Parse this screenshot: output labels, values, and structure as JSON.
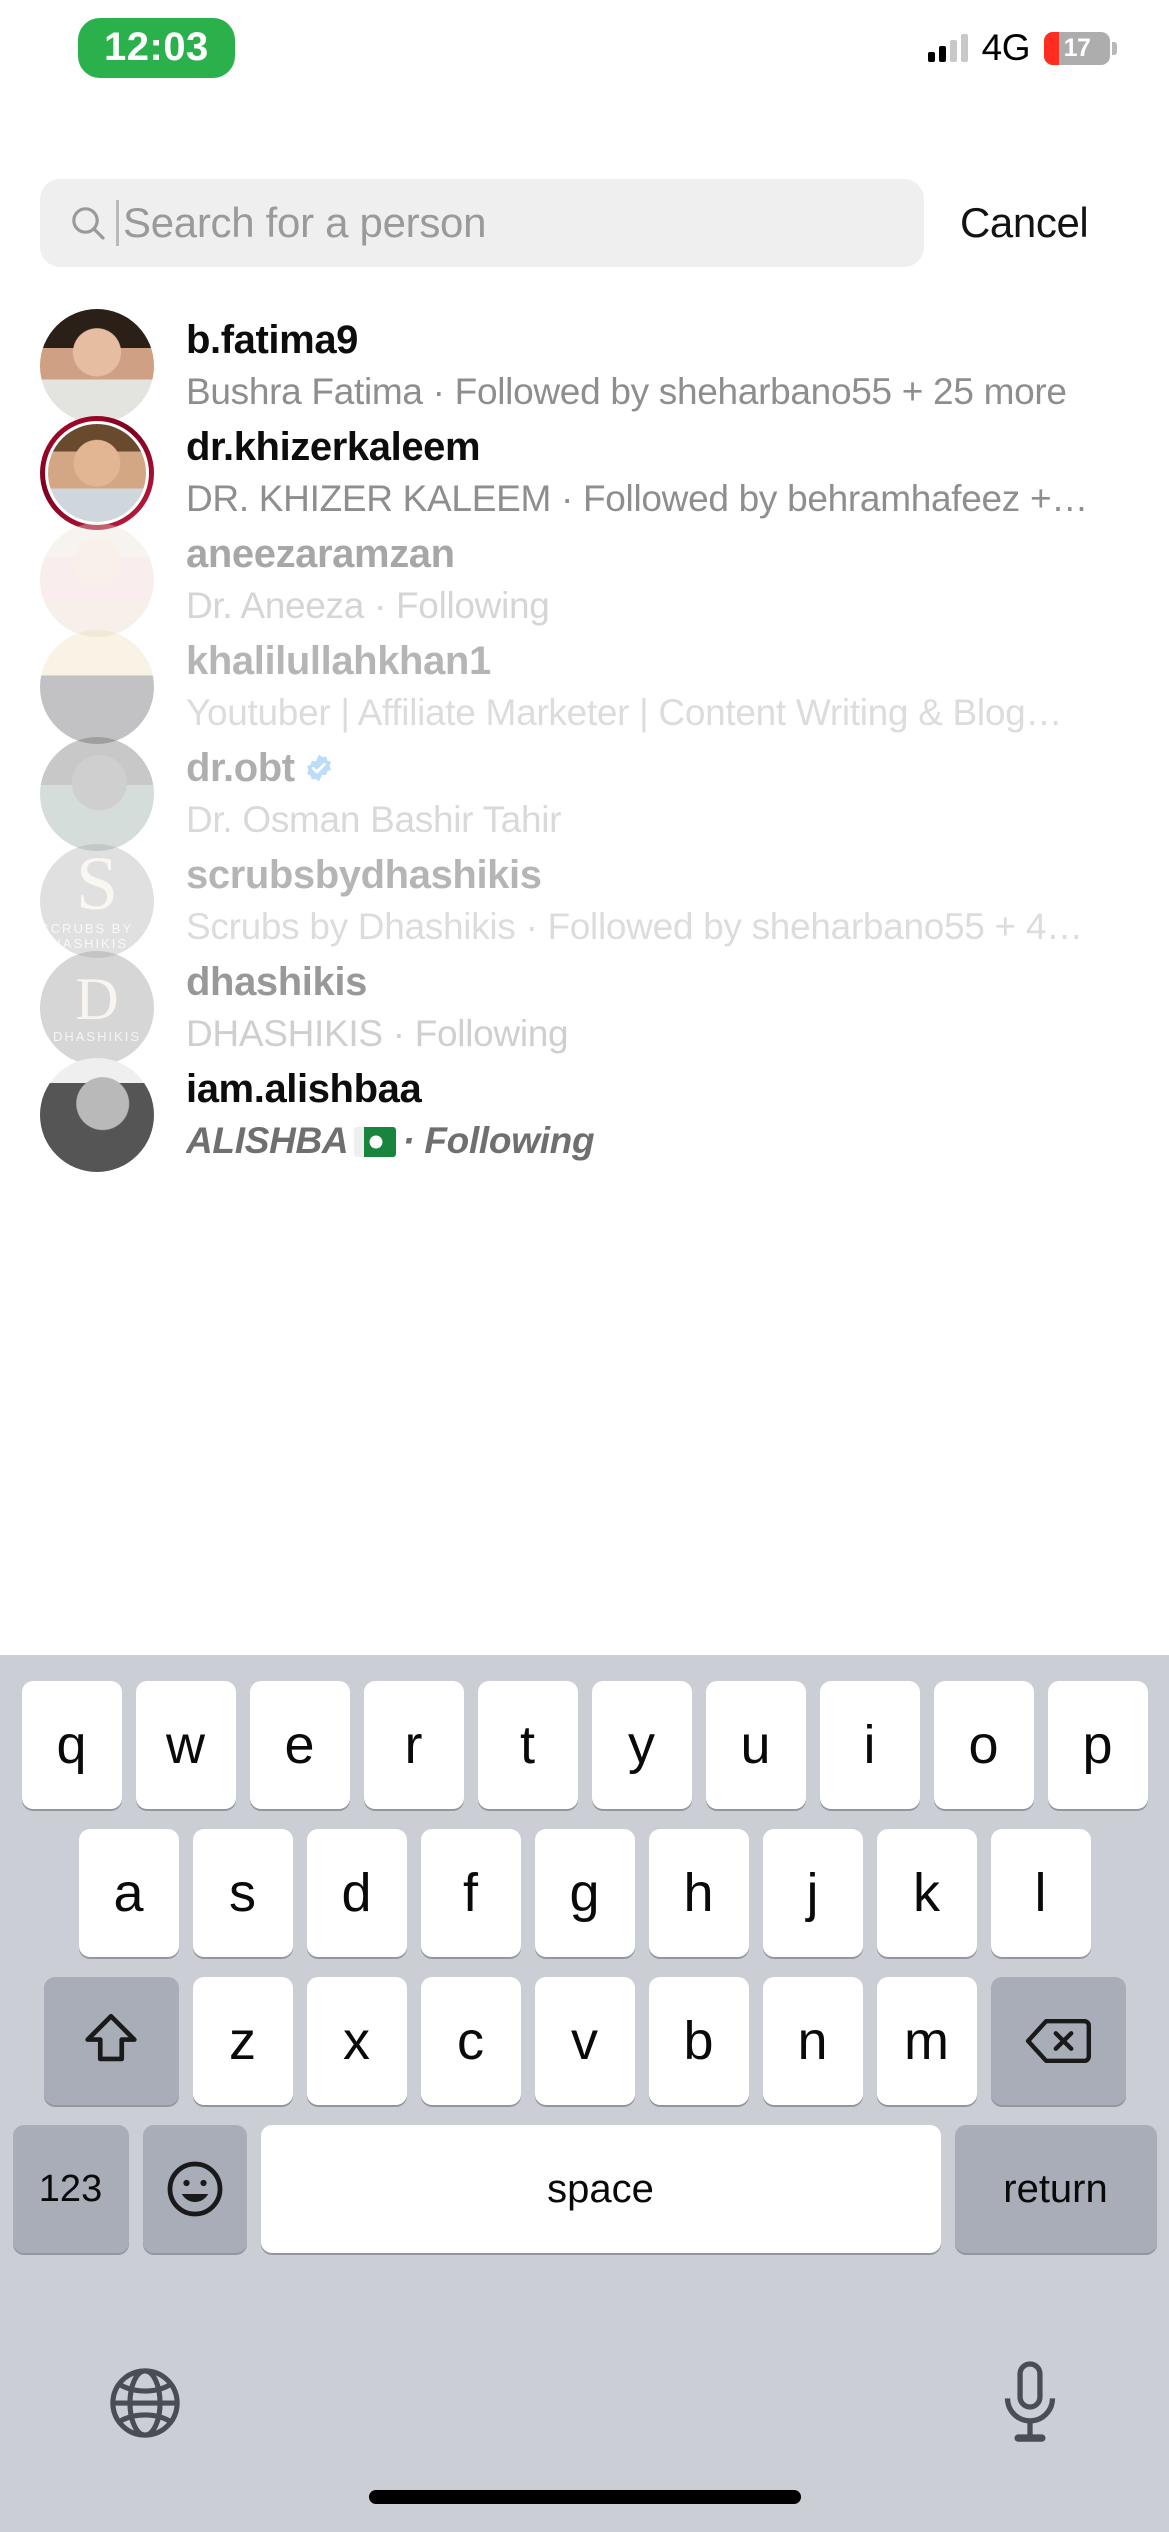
{
  "status_bar": {
    "time": "12:03",
    "time_pill_color": "#2bb14b",
    "network": "4G",
    "battery_percent": "17",
    "battery_low_color": "#ff2d20",
    "signal_icon": "cellular-signal-icon"
  },
  "search": {
    "placeholder": "Search for a person",
    "value": "",
    "icon": "search-icon",
    "cancel_label": "Cancel"
  },
  "results": [
    {
      "username": "b.fatima9",
      "subtitle": "Bushra Fatima · Followed by sheharbano55 + 25 more",
      "verified": false,
      "story_ring": false,
      "avatar": "profile-photo-b-fatima9"
    },
    {
      "username": "dr.khizerkaleem",
      "subtitle": "DR. KHIZER KALEEM · Followed by behramhafeez +…",
      "verified": false,
      "story_ring": true,
      "ring_color": "#a4082a",
      "avatar": "profile-photo-dr-khizerkaleem"
    },
    {
      "username": "aneezaramzan",
      "subtitle": "Dr. Aneeza · Following",
      "verified": false,
      "story_ring": false,
      "avatar": "profile-photo-aneezaramzan"
    },
    {
      "username": "khalilullahkhan1",
      "subtitle": "Youtuber | Affiliate Marketer | Content Writing & Blog…",
      "verified": false,
      "story_ring": false,
      "avatar": "profile-photo-khalilullahkhan1"
    },
    {
      "username": "dr.obt",
      "subtitle": "Dr. Osman Bashir Tahir",
      "verified": true,
      "verified_color": "#3897f0",
      "story_ring": false,
      "avatar": "profile-photo-dr-obt"
    },
    {
      "username": "scrubsbydhashikis",
      "subtitle": "Scrubs by Dhashikis · Followed by sheharbano55 + 4…",
      "verified": false,
      "story_ring": false,
      "avatar": "logo-scrubsbydhashikis",
      "logo_big": "S",
      "logo_small": "SCRUBS BY DHASHIKIS"
    },
    {
      "username": "dhashikis",
      "subtitle": "DHASHIKIS · Following",
      "verified": false,
      "story_ring": false,
      "avatar": "logo-dhashikis",
      "logo_big": "D",
      "logo_small": "DHASHIKIS"
    },
    {
      "username": "iam.alishbaa",
      "subtitle_prefix": "ALISHBA",
      "subtitle_suffix": "· Following",
      "flag": "pakistan-flag-emoji",
      "verified": false,
      "story_ring": false,
      "avatar": "profile-photo-iam-alishbaa"
    }
  ],
  "keyboard": {
    "row1": [
      "q",
      "w",
      "e",
      "r",
      "t",
      "y",
      "u",
      "i",
      "o",
      "p"
    ],
    "row2": [
      "a",
      "s",
      "d",
      "f",
      "g",
      "h",
      "j",
      "k",
      "l"
    ],
    "row3": [
      "z",
      "x",
      "c",
      "v",
      "b",
      "n",
      "m"
    ],
    "shift_icon": "shift-arrow-icon",
    "backspace_icon": "backspace-delete-icon",
    "numbers_label": "123",
    "emoji_icon": "emoji-smiley-icon",
    "space_label": "space",
    "return_label": "return",
    "globe_icon": "globe-language-icon",
    "mic_icon": "microphone-dictation-icon",
    "background_color": "#cbced5"
  }
}
